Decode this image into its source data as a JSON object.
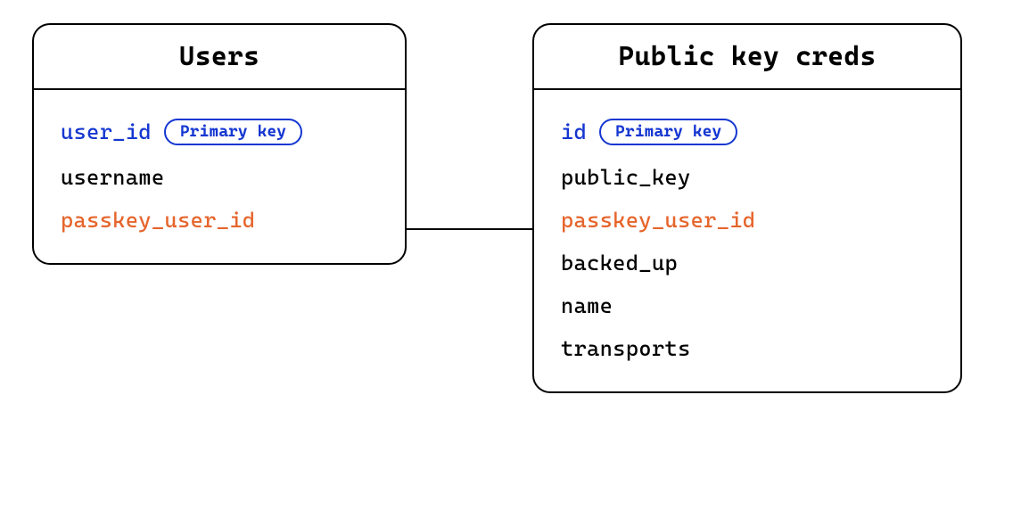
{
  "diagram": {
    "entities": {
      "users": {
        "title": "Users",
        "fields": [
          {
            "name": "user_id",
            "type": "primary",
            "badge": "Primary key"
          },
          {
            "name": "username",
            "type": "normal",
            "badge": null
          },
          {
            "name": "passkey_user_id",
            "type": "foreign",
            "badge": null
          }
        ]
      },
      "creds": {
        "title": "Public key creds",
        "fields": [
          {
            "name": "id",
            "type": "primary",
            "badge": "Primary key"
          },
          {
            "name": "public_key",
            "type": "normal",
            "badge": null
          },
          {
            "name": "passkey_user_id",
            "type": "foreign",
            "badge": null
          },
          {
            "name": "backed_up",
            "type": "normal",
            "badge": null
          },
          {
            "name": "name",
            "type": "normal",
            "badge": null
          },
          {
            "name": "transports",
            "type": "normal",
            "badge": null
          }
        ]
      }
    },
    "relationship": {
      "from": "users.passkey_user_id",
      "to": "creds.passkey_user_id"
    }
  },
  "colors": {
    "primary_key": "#1537d1",
    "foreign_key": "#e6652c",
    "normal": "#000000",
    "border": "#000000"
  }
}
